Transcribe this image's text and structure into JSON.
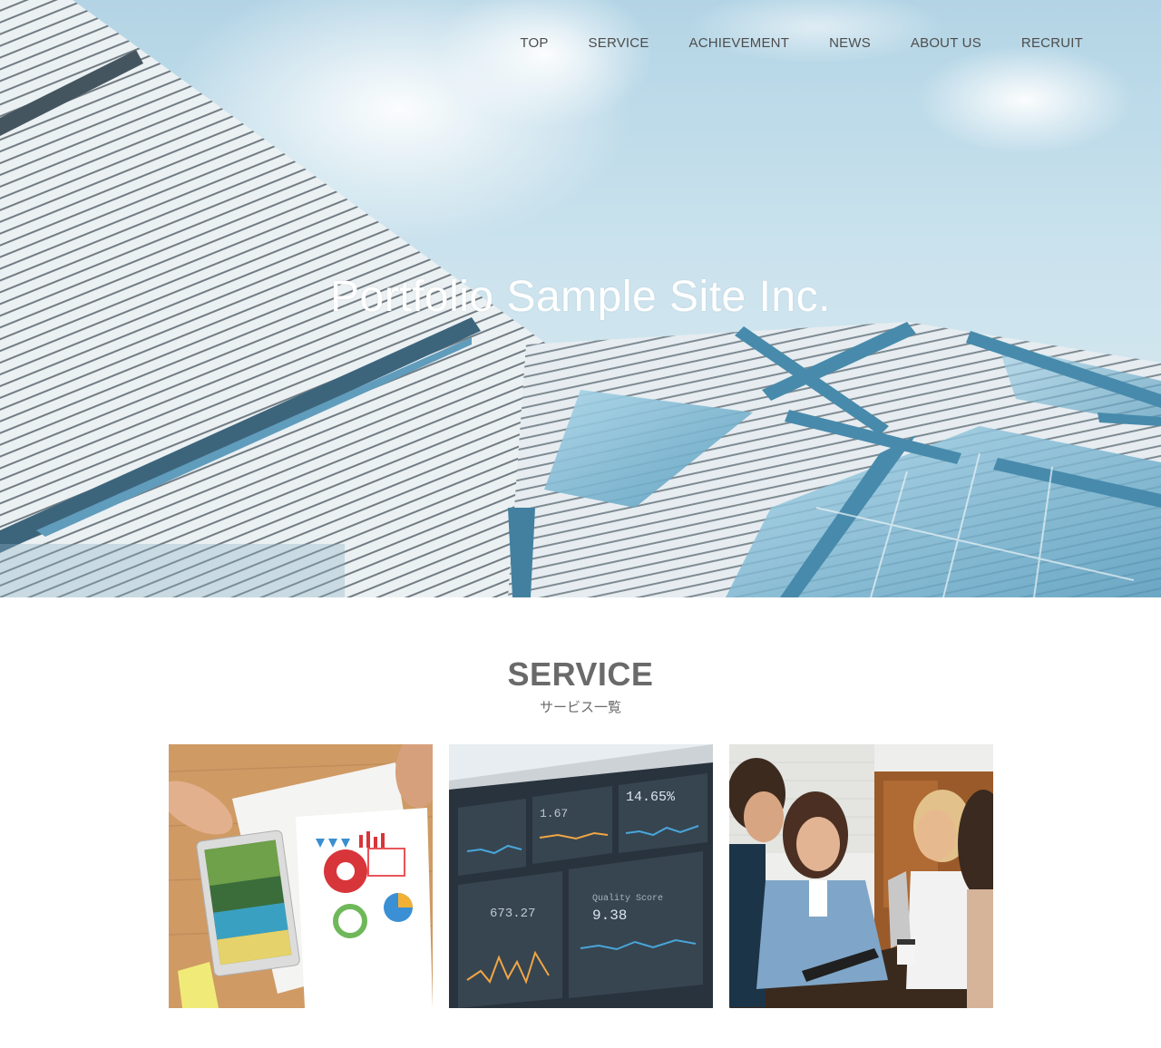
{
  "nav": {
    "items": [
      {
        "label": "TOP"
      },
      {
        "label": "SERVICE"
      },
      {
        "label": "ACHIEVEMENT"
      },
      {
        "label": "NEWS"
      },
      {
        "label": "ABOUT US"
      },
      {
        "label": "RECRUIT"
      }
    ]
  },
  "hero": {
    "title": "Portfolio Sample Site Inc."
  },
  "service": {
    "heading": "SERVICE",
    "subheading": "サービス一覧",
    "cards": [
      {
        "image": "tablet-and-charts-photo"
      },
      {
        "image": "analytics-dashboard-photo",
        "figures": [
          "14.65%",
          "1.67",
          "673.27",
          "9.38"
        ],
        "labels": [
          "Quality Score"
        ]
      },
      {
        "image": "team-meeting-photo"
      }
    ]
  },
  "colors": {
    "nav_text": "#4d4d4d",
    "heading_text": "#6a6a6a",
    "hero_title": "#ffffff",
    "sky": "#a9cfe2",
    "glass_blue": "#2f7aa0"
  }
}
